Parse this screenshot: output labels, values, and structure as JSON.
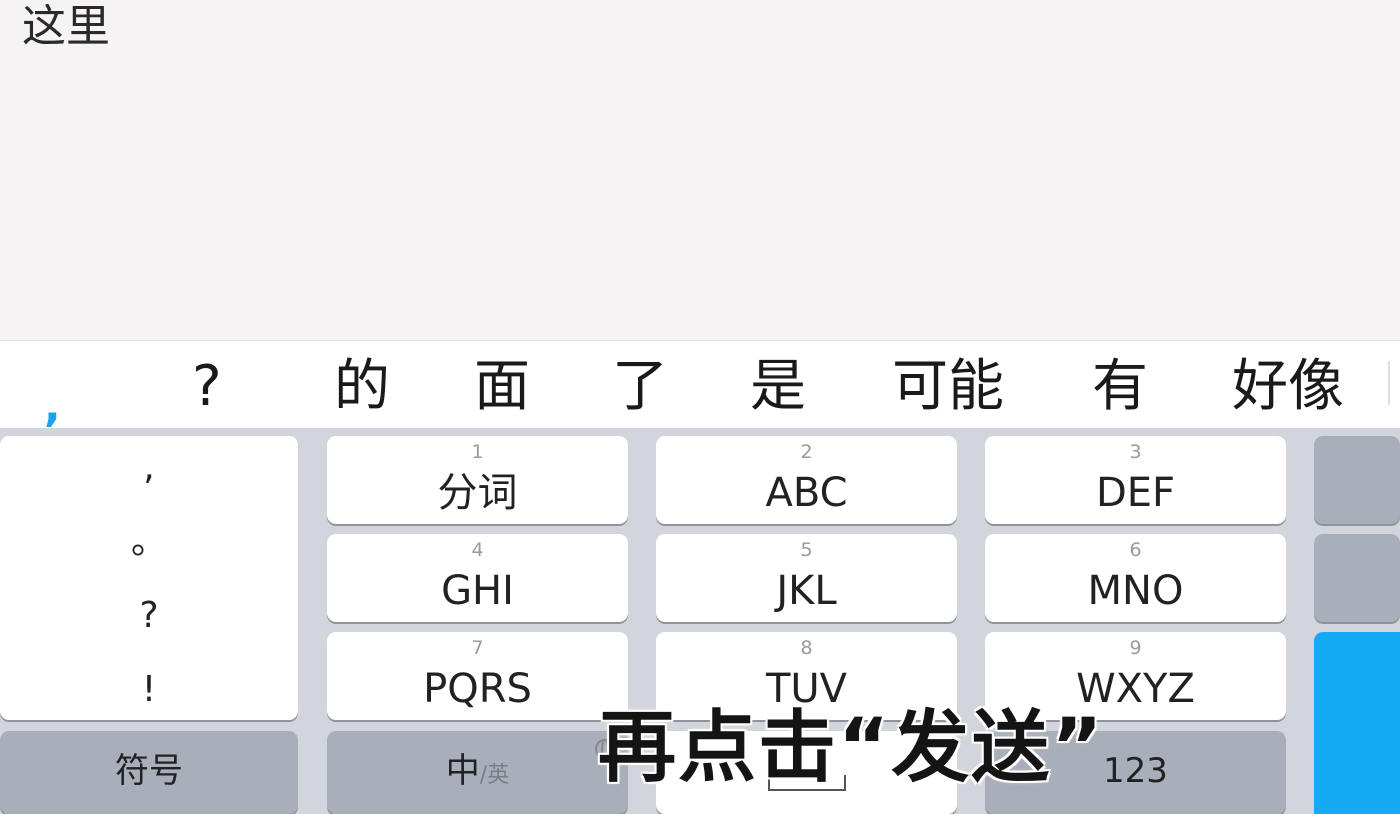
{
  "text_area": {
    "typed_text": "这里"
  },
  "candidates": [
    ",",
    "?",
    "的",
    "面",
    "了",
    "是",
    "可能",
    "有",
    "好像"
  ],
  "keyboard": {
    "punctuation": [
      ",",
      "。",
      "?",
      "!"
    ],
    "keys": [
      {
        "num": "1",
        "letters": "分词"
      },
      {
        "num": "2",
        "letters": "ABC"
      },
      {
        "num": "3",
        "letters": "DEF"
      },
      {
        "num": "4",
        "letters": "GHI"
      },
      {
        "num": "5",
        "letters": "JKL"
      },
      {
        "num": "6",
        "letters": "MNO"
      },
      {
        "num": "7",
        "letters": "PQRS"
      },
      {
        "num": "8",
        "letters": "TUV"
      },
      {
        "num": "9",
        "letters": "WXYZ"
      }
    ],
    "symbols_label": "符号",
    "lang_main": "中",
    "lang_sub": "/英",
    "numbers_label": "123"
  },
  "overlay": {
    "subtitle": "再点击“发送”"
  },
  "colors": {
    "accent_blue": "#16aaf5",
    "candidate_highlight": "#1aa3e8"
  }
}
